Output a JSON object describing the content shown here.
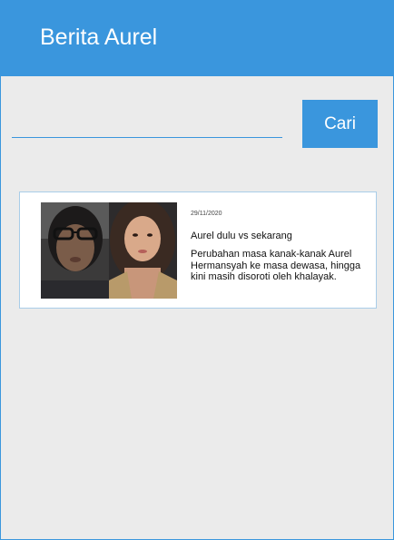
{
  "header": {
    "title": "Berita Aurel",
    "color": "#3a96dd"
  },
  "search": {
    "value": "",
    "placeholder": "",
    "button_label": "Cari"
  },
  "news": [
    {
      "date": "29/11/2020",
      "title": "Aurel dulu vs sekarang",
      "summary": "Perubahan masa kanak-kanak Aurel Hermansyah ke masa dewasa, hingga kini masih disoroti oleh khalayak.",
      "image": "before-after-photo"
    }
  ]
}
